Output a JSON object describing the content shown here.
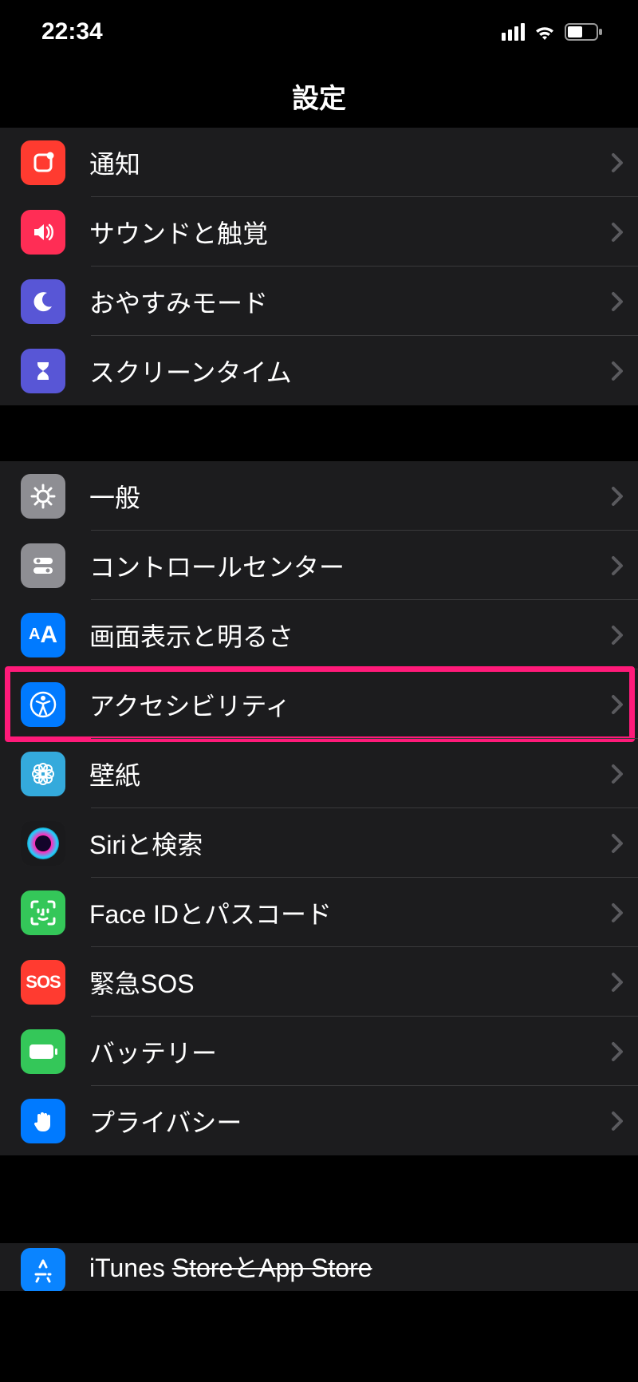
{
  "status": {
    "time": "22:34"
  },
  "header": {
    "title": "設定"
  },
  "sections": [
    {
      "rows": [
        {
          "id": "notifications",
          "label": "通知",
          "icon": "notifications",
          "highlighted": false
        },
        {
          "id": "sounds",
          "label": "サウンドと触覚",
          "icon": "sounds",
          "highlighted": false
        },
        {
          "id": "dnd",
          "label": "おやすみモード",
          "icon": "moon",
          "highlighted": false
        },
        {
          "id": "screentime",
          "label": "スクリーンタイム",
          "icon": "hourglass",
          "highlighted": false
        }
      ]
    },
    {
      "rows": [
        {
          "id": "general",
          "label": "一般",
          "icon": "gear",
          "highlighted": false
        },
        {
          "id": "control",
          "label": "コントロールセンター",
          "icon": "toggles",
          "highlighted": false
        },
        {
          "id": "display",
          "label": "画面表示と明るさ",
          "icon": "aa",
          "highlighted": false
        },
        {
          "id": "accessibility",
          "label": "アクセシビリティ",
          "icon": "accessibility",
          "highlighted": true
        },
        {
          "id": "wallpaper",
          "label": "壁紙",
          "icon": "flower",
          "highlighted": false
        },
        {
          "id": "siri",
          "label": "Siriと検索",
          "icon": "siri",
          "highlighted": false
        },
        {
          "id": "faceid",
          "label": "Face IDとパスコード",
          "icon": "faceid",
          "highlighted": false
        },
        {
          "id": "sos",
          "label": "緊急SOS",
          "icon": "sos",
          "highlighted": false
        },
        {
          "id": "battery",
          "label": "バッテリー",
          "icon": "battery",
          "highlighted": false
        },
        {
          "id": "privacy",
          "label": "プライバシー",
          "icon": "hand",
          "highlighted": false
        }
      ]
    },
    {
      "rows": [
        {
          "id": "itunes",
          "label": "iTunes StoreとApp Store",
          "label_strike_from": 7,
          "icon": "appstore",
          "highlighted": false
        }
      ]
    }
  ]
}
